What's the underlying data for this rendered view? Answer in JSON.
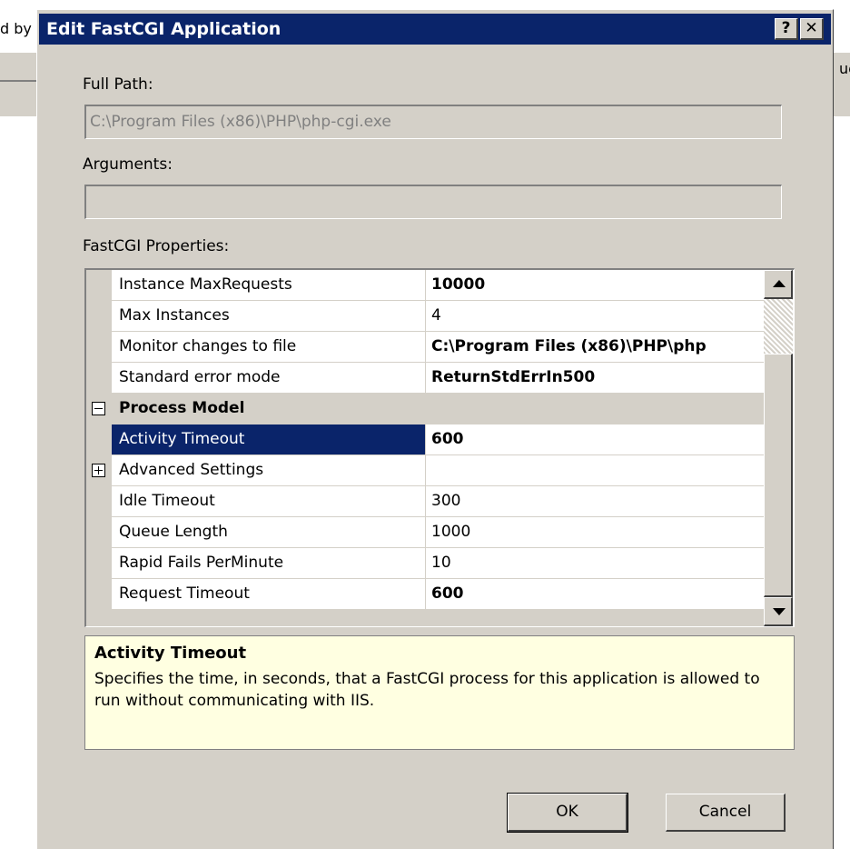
{
  "background_window": {
    "left_text_fragment": "d by",
    "right_text_fragment": "ue"
  },
  "dialog": {
    "title": "Edit FastCGI Application",
    "help_button": "?",
    "close_button": "✕",
    "full_path": {
      "label": "Full Path:",
      "value": "C:\\Program Files (x86)\\PHP\\php-cgi.exe"
    },
    "arguments": {
      "label": "Arguments:",
      "value": ""
    },
    "properties_label": "FastCGI Properties:",
    "properties": [
      {
        "name": "Instance MaxRequests",
        "value": "10000",
        "bold": true,
        "type": "property"
      },
      {
        "name": "Max Instances",
        "value": "4",
        "bold": false,
        "type": "property"
      },
      {
        "name": "Monitor changes to file",
        "value": "C:\\Program Files (x86)\\PHP\\php",
        "bold": true,
        "type": "property"
      },
      {
        "name": "Standard error mode",
        "value": "ReturnStdErrIn500",
        "bold": true,
        "type": "property"
      },
      {
        "name": "Process Model",
        "value": "",
        "bold": true,
        "type": "category",
        "expander": "⊟"
      },
      {
        "name": "Activity Timeout",
        "value": "600",
        "bold": true,
        "type": "property",
        "selected": true
      },
      {
        "name": "Advanced Settings",
        "value": "",
        "bold": false,
        "type": "subcategory",
        "expander": "⊞"
      },
      {
        "name": "Idle Timeout",
        "value": "300",
        "bold": false,
        "type": "property"
      },
      {
        "name": "Queue Length",
        "value": "1000",
        "bold": false,
        "type": "property"
      },
      {
        "name": "Rapid Fails PerMinute",
        "value": "10",
        "bold": false,
        "type": "property"
      },
      {
        "name": "Request Timeout",
        "value": "600",
        "bold": true,
        "type": "property"
      }
    ],
    "description": {
      "title": "Activity Timeout",
      "text": "Specifies the time, in seconds, that a FastCGI process for this application is allowed to run without communicating with IIS."
    },
    "buttons": {
      "ok": "OK",
      "cancel": "Cancel"
    }
  },
  "colors": {
    "titlebar": "#0a246a",
    "face": "#d4d0c8",
    "selection": "#0a246a",
    "description_bg": "#ffffe1"
  }
}
